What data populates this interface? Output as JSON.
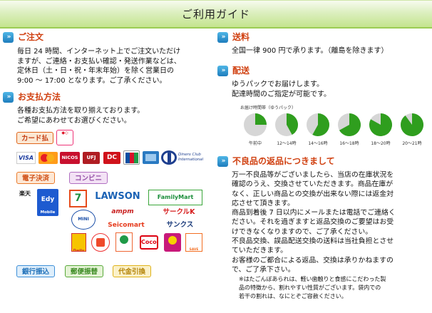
{
  "page_title": "ご利用ガイド",
  "order": {
    "title": "ご注文",
    "text": "毎日 24 時間、インターネット上でご注文いただけ\nますが、ご連絡・お支払い確認・発送作業などは、\n定休日（土・日・祝・年末年始）を除く営業日の\n9:00 ～ 17:00 となります。ご了承ください。"
  },
  "payment": {
    "title": "お支払方法",
    "text": "各種お支払方法を取り揃えております。\nご希望にあわせてお選びください。",
    "card_label": "カード払",
    "card_brands": [
      "VISA",
      "MasterCard",
      "NICOS",
      "UFJ",
      "DC",
      "JCB",
      "AMEX",
      "Diners Club International"
    ],
    "e_payment_label": "電子決済",
    "convenience_label": "コンビニ",
    "e_money": [
      "楽天",
      "Edy"
    ],
    "convenience_stores": [
      "7",
      "LAWSON",
      "FamilyMart",
      "MINI STOP",
      "ampm",
      "サークルK",
      "Seicomart",
      "サンクス",
      "Daily",
      "",
      "",
      "Coco!",
      "",
      "SAVE ON"
    ],
    "bank_label": "銀行振込",
    "postal_label": "郵便振替",
    "cod_label": "代金引換"
  },
  "shipping_fee": {
    "title": "送料",
    "text": "全国一律 900 円で承ります。（離島を除きます）"
  },
  "delivery": {
    "title": "配送",
    "text": "ゆうパックでお届けします。\n配達時間のご指定が可能です。",
    "time_slots_title": "お届け時間帯（ゆうパック）",
    "time_slots": [
      {
        "label": "午前中",
        "fraction": 0.25
      },
      {
        "label": "12～14時",
        "fraction": 0.42
      },
      {
        "label": "14～16時",
        "fraction": 0.58
      },
      {
        "label": "16～18時",
        "fraction": 0.67
      },
      {
        "label": "18～20時",
        "fraction": 0.83
      },
      {
        "label": "20～21時",
        "fraction": 0.9
      }
    ],
    "colors": {
      "fill": "#2f9e1e",
      "empty": "#d6d6d6"
    }
  },
  "returns": {
    "title": "不良品の返品につきまして",
    "text": "万一不良品等がございましたら、当店の在庫状況を\n確認のうえ、交換させていただきます。商品在庫が\nなく、正しい商品との交換が出来ない際には返金対\n応させて頂きます。\n商品到着後 7 日以内にメールまたは電話でご連絡く\nださい。それを過ぎますと返品交換のご要望はお受\nけできなくなりますので、ご了承ください。\n不良品交換、誤品配送交換の送料は当社負担とさせ\nていただきます。\nお客様のご都合による返品、交換は承りかねますの\nで、ご了承下さい。",
    "note": "※はたごんぼあられは、軽い歯触りと食感にこだわった製\n品の特徴から、割れやすい性質がございます。袋内での\n若干の割れは、なにとぞご容赦ください。"
  },
  "colors": {
    "heading": "#d04010",
    "accent": "#9ccc55"
  }
}
